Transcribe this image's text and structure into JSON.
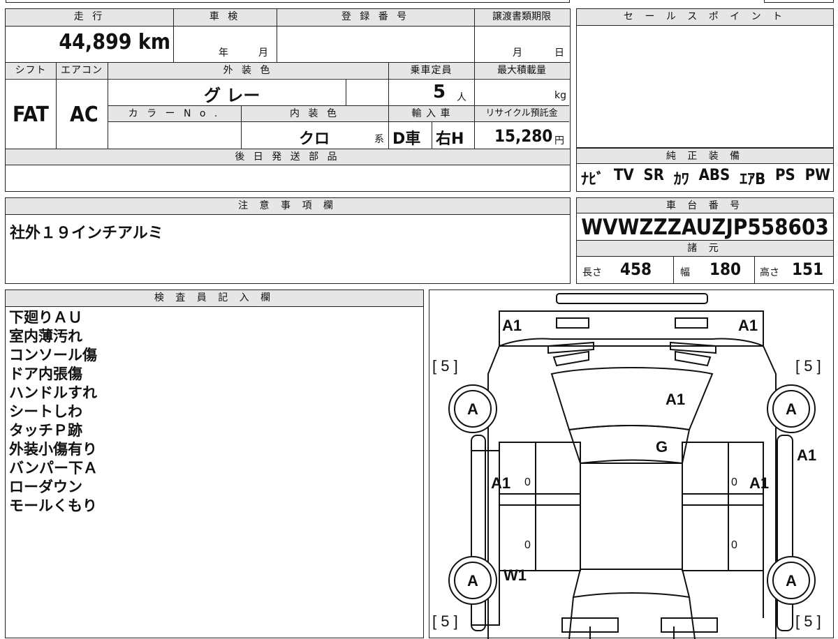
{
  "top_strip": {
    "left_text": "",
    "mid_text": ""
  },
  "mileage": {
    "label": "走 行",
    "value": "44,899",
    "unit": "km"
  },
  "inspection": {
    "label": "車 検",
    "year": "年",
    "month": "月"
  },
  "registration": {
    "label": "登 録 番 号",
    "value": ""
  },
  "transfer": {
    "label": "譲渡書類期限",
    "month": "月",
    "day": "日"
  },
  "sale_points": {
    "label": "セ ー ル ス ポ イ ン ト",
    "value": ""
  },
  "shift": {
    "label": "シフト",
    "value": "FAT"
  },
  "aircon": {
    "label": "エアコン",
    "value": "AC"
  },
  "exterior_color": {
    "label": "外 装 色",
    "value": "グ レー"
  },
  "capacity": {
    "label": "乗車定員",
    "value": "5",
    "unit": "人"
  },
  "max_load": {
    "label": "最大積載量",
    "unit": "kg"
  },
  "color_no": {
    "label": "カ ラ ー N o ."
  },
  "interior_color": {
    "label": "内 装 色",
    "value": "クロ",
    "suffix": "系"
  },
  "import": {
    "label": "輸 入 車",
    "dealer": "D車",
    "handle": "右H"
  },
  "recycle": {
    "label": "リサイクル預託金",
    "value": "15,280",
    "unit": "円"
  },
  "later_parts": {
    "label": "後 日 発 送 部 品",
    "value": ""
  },
  "genuine_equipment": {
    "label": "純 正 装 備",
    "items": [
      "ﾅﾋﾞ",
      "TV",
      "SR",
      "ｶﾜ",
      "ABS",
      "ｴｱB",
      "PS",
      "PW"
    ]
  },
  "notes": {
    "label": "注 意 事 項 欄",
    "text": "社外１９インチアルミ"
  },
  "chassis": {
    "label": "車 台 番 号",
    "value": "WVWZZZAUZJP558603"
  },
  "specs": {
    "label": "諸 元",
    "length_label": "長さ",
    "length": "458",
    "width_label": "幅",
    "width": "180",
    "height_label": "高さ",
    "height": "151"
  },
  "inspector": {
    "label": "検 査 員 記 入 欄",
    "lines": [
      "下廻りＡＵ",
      "室内薄汚れ",
      "コンソール傷",
      "ドア内張傷",
      "ハンドルすれ",
      "シートしわ",
      "タッチＰ跡",
      "外装小傷有り",
      "バンパー下Ａ",
      "ローダウン",
      "モールくもり"
    ]
  },
  "diagram": {
    "marks": {
      "front_left": "A1",
      "front_right": "A1",
      "hood": "A1",
      "windshield": "G",
      "left_front_door": "A1",
      "right_front_door": "A1",
      "right_fender": "A1",
      "left_rear_wheel": "W1"
    },
    "tire_left_top": "[ 5 ]",
    "tire_right_top": "[ 5 ]",
    "tire_left_bottom": "[ 5 ]",
    "tire_right_bottom": "[ 5 ]",
    "wheels": {
      "fl": "A",
      "fr": "A",
      "rl": "A",
      "rr": "A"
    },
    "zeros": [
      "0",
      "0",
      "0",
      "0"
    ]
  }
}
